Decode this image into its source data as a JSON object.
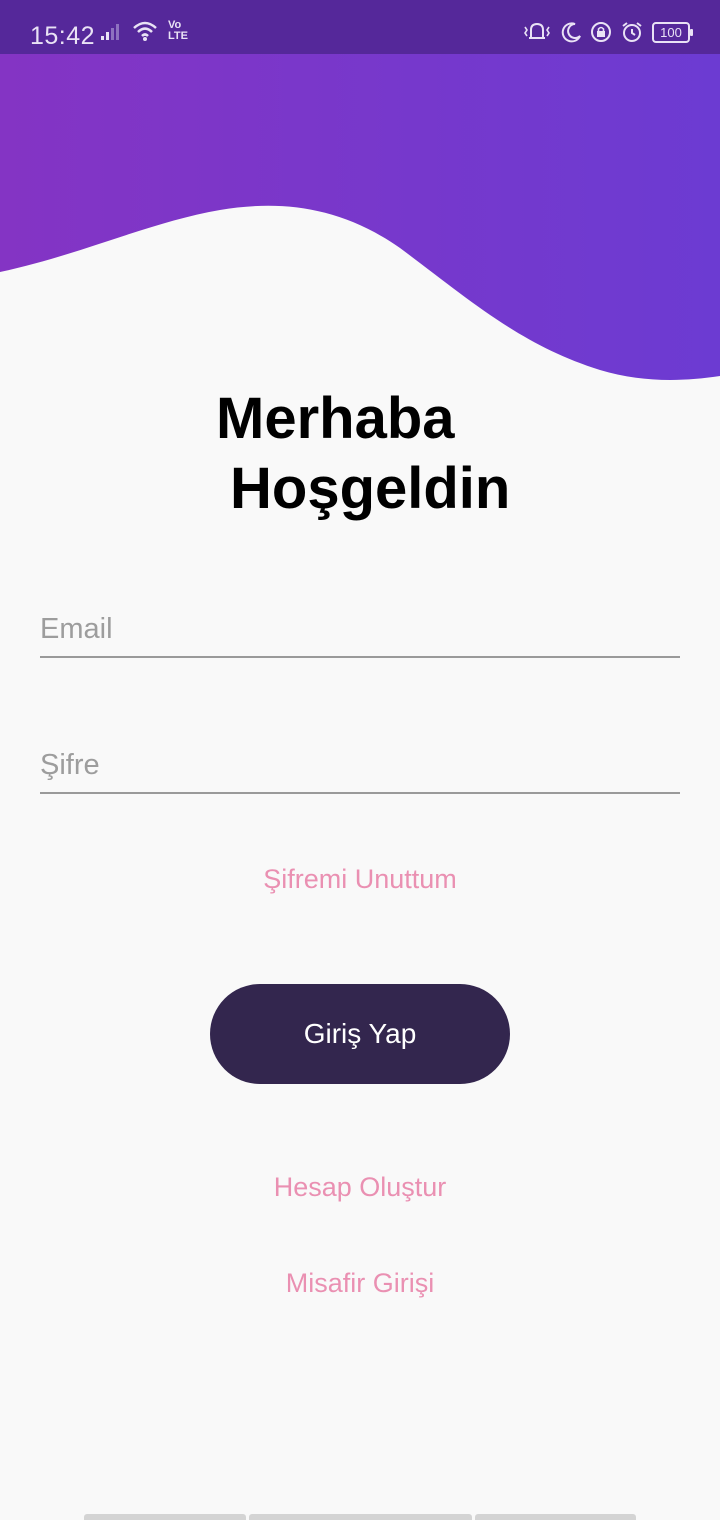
{
  "status_bar": {
    "time": "15:42",
    "volte_top": "Vo",
    "volte_bottom": "LTE",
    "battery": "100",
    "icons": [
      "signal-icon",
      "wifi-icon",
      "volte-icon",
      "vibrate-icon",
      "do-not-disturb-moon-icon",
      "screen-lock-icon",
      "alarm-icon",
      "battery-icon"
    ]
  },
  "header": {
    "gradient_start": "#8434c4",
    "gradient_end": "#6c3bd2"
  },
  "greeting": {
    "line1": "Merhaba",
    "line2": "Hoşgeldin"
  },
  "form": {
    "email": {
      "placeholder": "Email",
      "value": ""
    },
    "password": {
      "placeholder": "Şifre",
      "value": ""
    },
    "forgot_password_label": "Şifremi Unuttum",
    "login_button_label": "Giriş Yap",
    "create_account_label": "Hesap Oluştur",
    "guest_login_label": "Misafir Girişi"
  },
  "colors": {
    "background": "#f9f9f9",
    "primary_button": "#33264e",
    "link": "#ea90b2",
    "status_bar": "#55289a"
  }
}
